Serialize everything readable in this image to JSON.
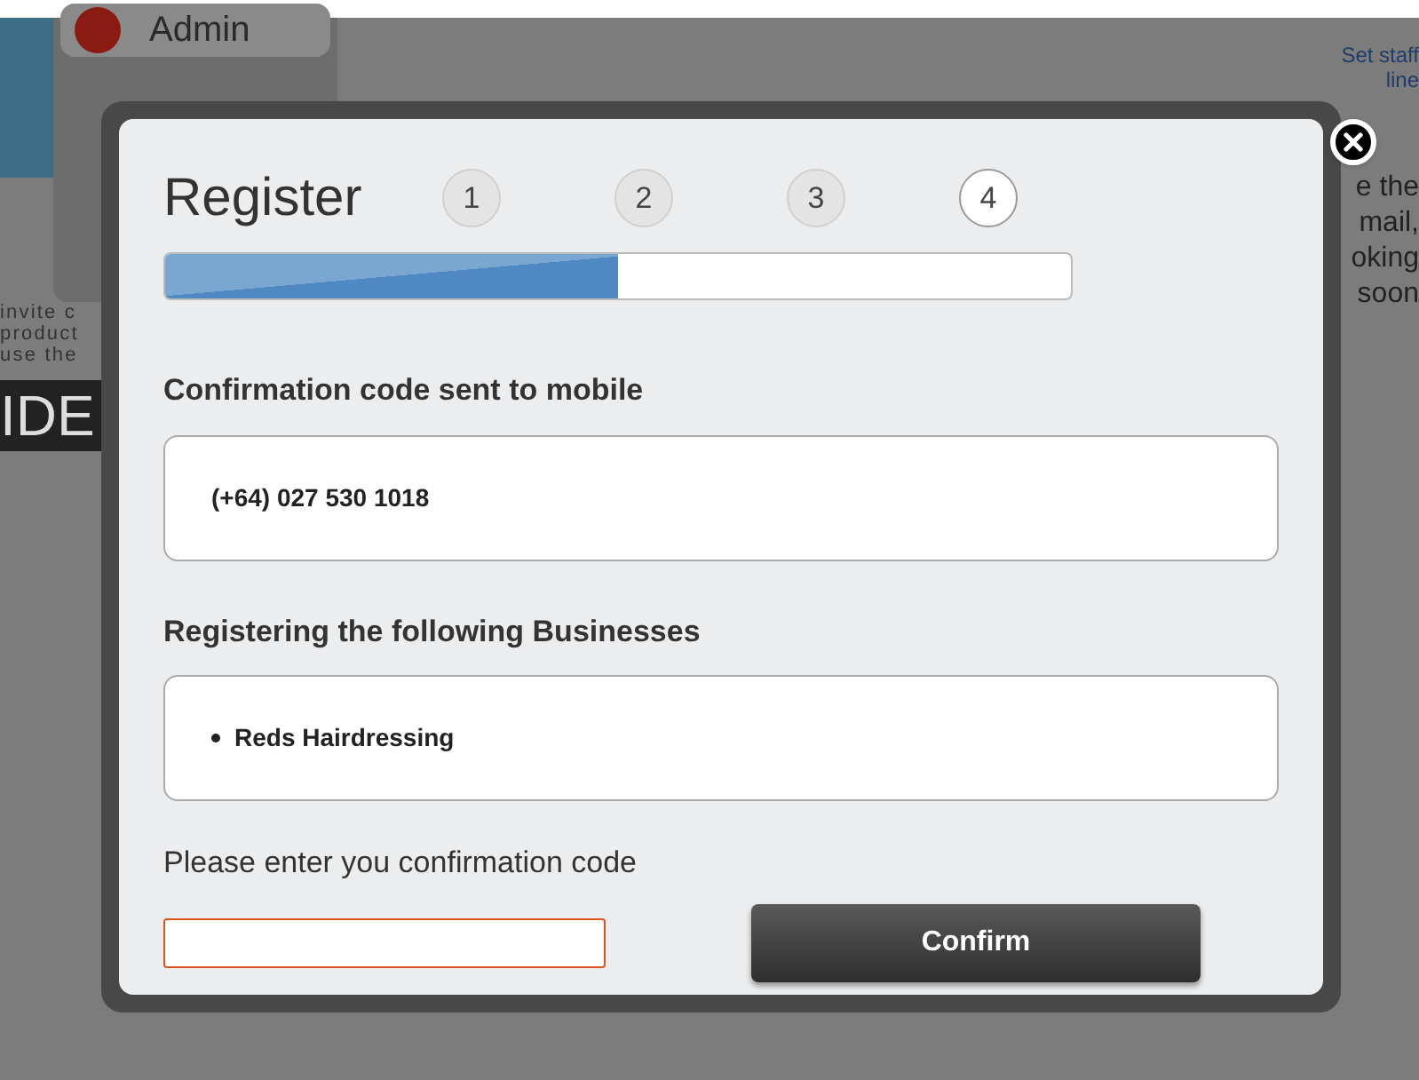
{
  "background": {
    "admin_label": "Admin",
    "left_text": [
      "invite c",
      "product",
      "use the"
    ],
    "big_text": "IDE",
    "link_lines": [
      "Set staff",
      "line"
    ],
    "right_text": [
      "e the",
      "mail,",
      "oking",
      "soon"
    ]
  },
  "dialog": {
    "title": "Register",
    "steps": [
      {
        "label": "1",
        "selected": false
      },
      {
        "label": "2",
        "selected": false
      },
      {
        "label": "3",
        "selected": false
      },
      {
        "label": "4",
        "selected": true
      }
    ],
    "progress": {
      "level": 0.5
    },
    "mobile_heading": "Confirmation code sent to mobile",
    "mobile_number": "(+64) 027 530 1018",
    "businesses_heading": "Registering the following Businesses",
    "businesses": [
      "Reds Hairdressing"
    ],
    "code_label": "Please enter you confirmation code",
    "confirm_button": "Confirm"
  }
}
